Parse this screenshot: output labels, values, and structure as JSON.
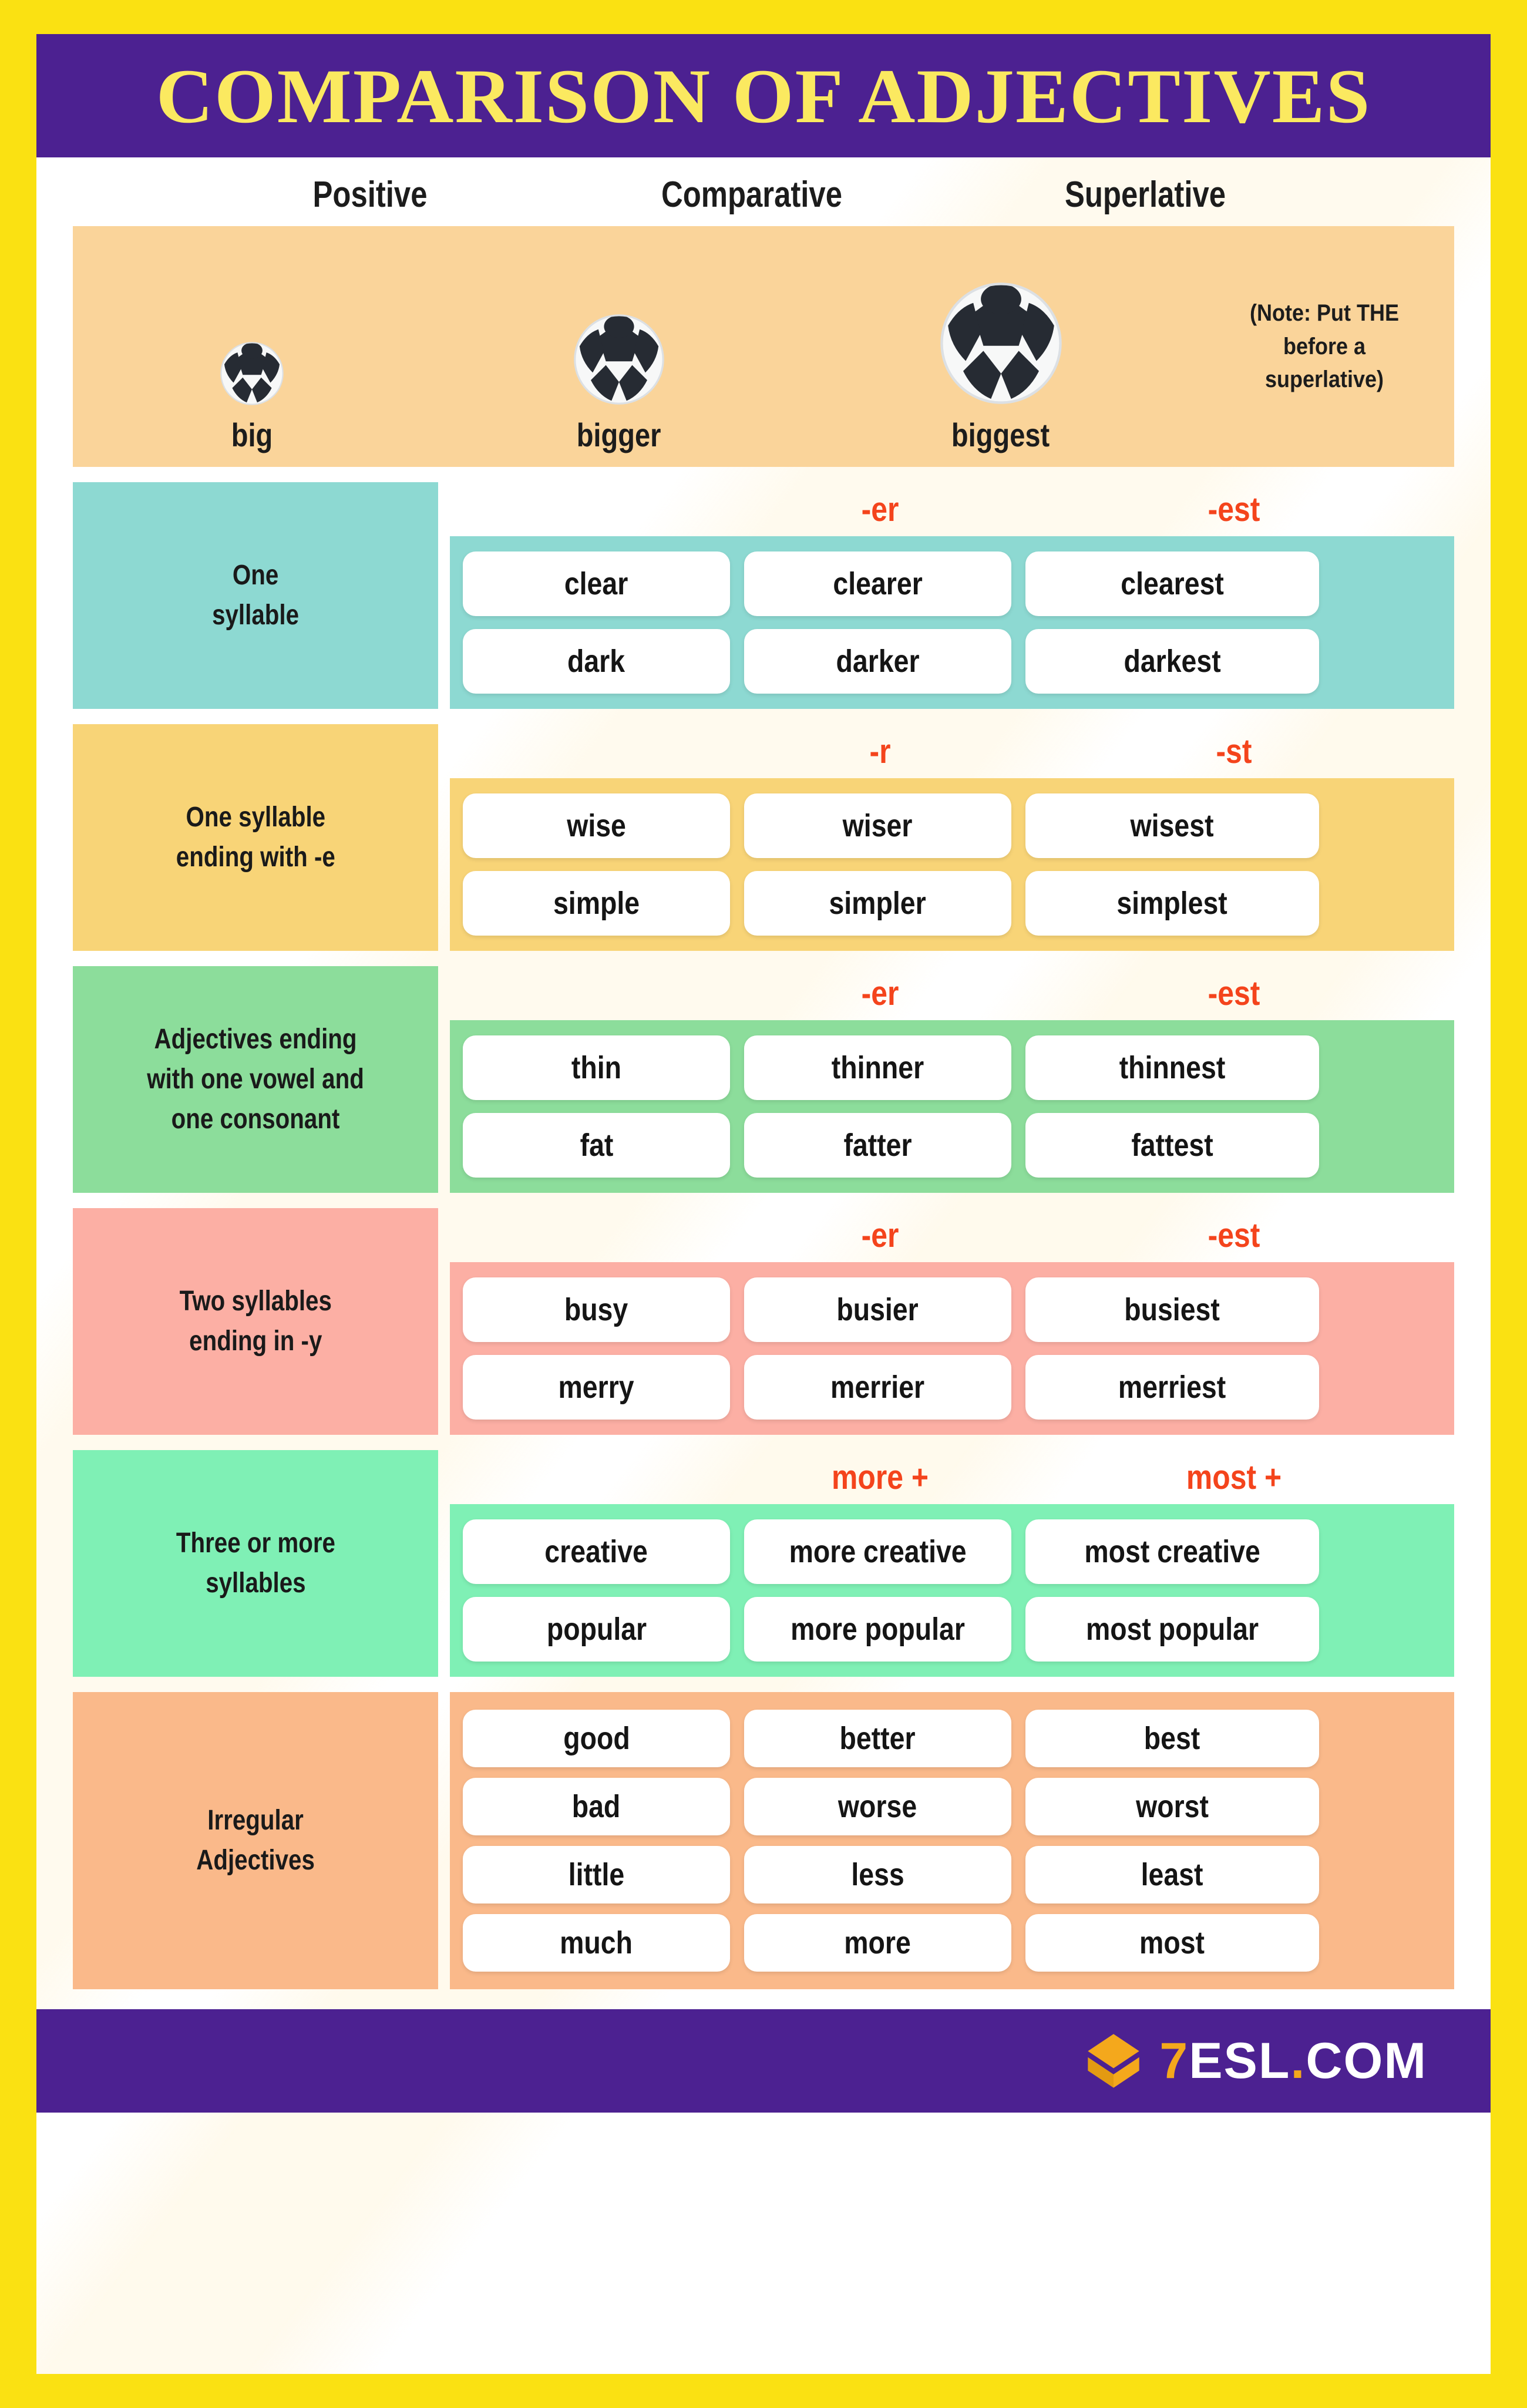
{
  "title": "COMPARISON OF ADJECTIVES",
  "colors": {
    "page_border": "#FAE112",
    "header_bg": "#4C2191",
    "header_text": "#FBE960",
    "suffix_text": "#F4441C",
    "intro_panel": "#FAD49A",
    "logo_accent": "#F4A81C"
  },
  "column_headers": {
    "positive": "Positive",
    "comparative": "Comparative",
    "superlative": "Superlative"
  },
  "intro": {
    "positive_label": "big",
    "comparative_label": "bigger",
    "superlative_label": "biggest",
    "note": "(Note: Put THE before a superlative)"
  },
  "rows": [
    {
      "label": "One\nsyllable",
      "color": "#8DD9D2",
      "suffix_comparative": "-er",
      "suffix_superlative": "-est",
      "words": [
        {
          "positive": "clear",
          "comparative": "clearer",
          "superlative": "clearest"
        },
        {
          "positive": "dark",
          "comparative": "darker",
          "superlative": "darkest"
        }
      ]
    },
    {
      "label": "One syllable\nending with -e",
      "color": "#F8D477",
      "suffix_comparative": "-r",
      "suffix_superlative": "-st",
      "words": [
        {
          "positive": "wise",
          "comparative": "wiser",
          "superlative": "wisest"
        },
        {
          "positive": "simple",
          "comparative": "simpler",
          "superlative": "simplest"
        }
      ]
    },
    {
      "label": "Adjectives ending\nwith one vowel and\none consonant",
      "color": "#8CDD9B",
      "suffix_comparative": "-er",
      "suffix_superlative": "-est",
      "words": [
        {
          "positive": "thin",
          "comparative": "thinner",
          "superlative": "thinnest"
        },
        {
          "positive": "fat",
          "comparative": "fatter",
          "superlative": "fattest"
        }
      ]
    },
    {
      "label": "Two syllables\nending in -y",
      "color": "#FCAFA4",
      "suffix_comparative": "-er",
      "suffix_superlative": "-est",
      "words": [
        {
          "positive": "busy",
          "comparative": "busier",
          "superlative": "busiest"
        },
        {
          "positive": "merry",
          "comparative": "merrier",
          "superlative": "merriest"
        }
      ]
    },
    {
      "label": "Three or more\nsyllables",
      "color": "#7FF0B5",
      "suffix_comparative": "more +",
      "suffix_superlative": "most +",
      "words": [
        {
          "positive": "creative",
          "comparative": "more creative",
          "superlative": "most creative"
        },
        {
          "positive": "popular",
          "comparative": "more popular",
          "superlative": "most popular"
        }
      ]
    },
    {
      "label": "Irregular\nAdjectives",
      "color": "#FAB98A",
      "suffix_comparative": "",
      "suffix_superlative": "",
      "words": [
        {
          "positive": "good",
          "comparative": "better",
          "superlative": "best"
        },
        {
          "positive": "bad",
          "comparative": "worse",
          "superlative": "worst"
        },
        {
          "positive": "little",
          "comparative": "less",
          "superlative": "least"
        },
        {
          "positive": "much",
          "comparative": "more",
          "superlative": "most"
        }
      ]
    }
  ],
  "footer": {
    "brand_digit": "7",
    "brand_name": "ESL",
    "brand_dot": ".",
    "brand_tld": "COM"
  }
}
